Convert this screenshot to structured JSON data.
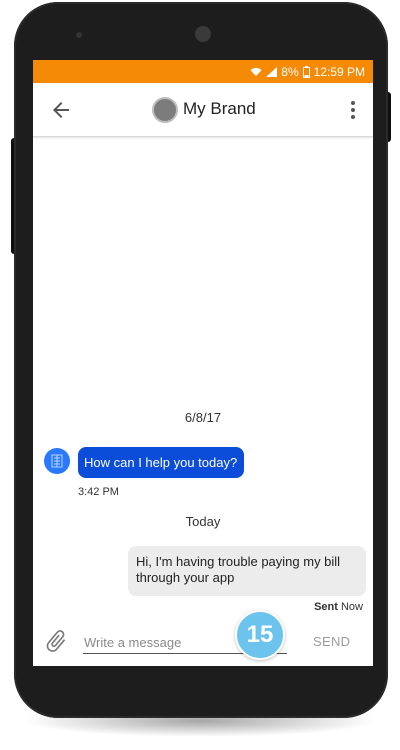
{
  "status_bar": {
    "battery": "8%",
    "time": "12:59 PM"
  },
  "header": {
    "title": "My Brand"
  },
  "conversation": {
    "date_separator_1": "6/8/17",
    "incoming_message": "How can I help you today?",
    "incoming_time": "3:42 PM",
    "date_separator_2": "Today",
    "outgoing_message": "Hi, I'm having trouble paying my bill through your app",
    "sent_label": "Sent",
    "sent_time": "Now"
  },
  "composer": {
    "placeholder": "Write a message",
    "send_label": "SEND"
  },
  "badge": {
    "number": "15"
  },
  "colors": {
    "status_bar": "#f58a07",
    "incoming_bubble": "#0b4dd8",
    "outgoing_bubble": "#ececec",
    "badge": "#6cc4ee"
  }
}
